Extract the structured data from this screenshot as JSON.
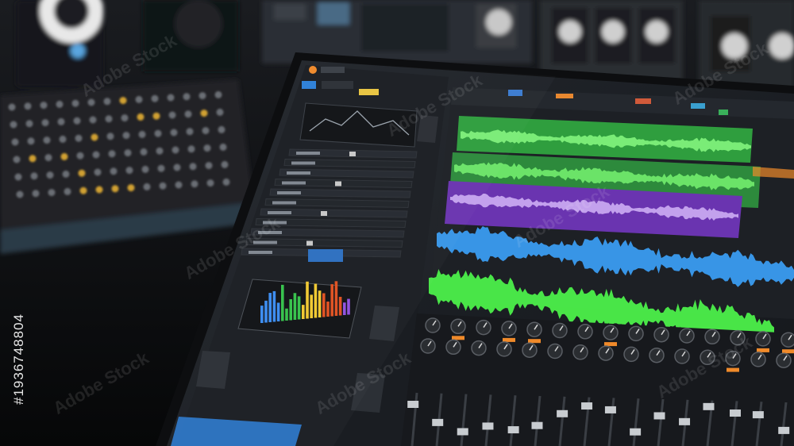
{
  "scene": {
    "description_kind": "photo",
    "colors": {
      "background": "#0b0c0e",
      "daw_panel": "#1c1f24",
      "track_green": "#35c24a",
      "track_purple": "#7d3fc2",
      "track_blue": "#2d7fd8",
      "track_bright_green": "#4cf04a",
      "accent_orange": "#f08a2a"
    },
    "eq_display_colors": [
      "#3a8cf0",
      "#35c24a",
      "#f0c830",
      "#e05020",
      "#9050e0"
    ]
  },
  "watermarks": {
    "stock_text": "Adobe Stock",
    "asset_id": "#193674880​4"
  }
}
